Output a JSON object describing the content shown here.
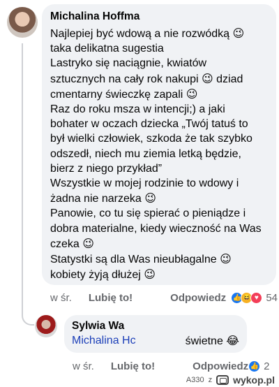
{
  "comment": {
    "author": "Michalina Hoffmann",
    "author_shown": "Michalina Hoffma",
    "lines": [
      {
        "text": "Najlepiej być wdową a nie rozwódką ",
        "emoji": "😉"
      },
      {
        "text": "taka delikatna sugestia",
        "emoji": ""
      },
      {
        "text": "Lastryko się naciągnie, kwiatów",
        "emoji": ""
      },
      {
        "text": "sztucznych na cały rok nakupi ",
        "emoji": "😉",
        "after": " dziad"
      },
      {
        "text": "cmentarny świeczkę zapali ",
        "emoji": "😉"
      },
      {
        "text": "Raz do roku msza w intencji;) a jaki",
        "emoji": ""
      },
      {
        "text": "bohater w oczach dziecka „Twój tatuś to",
        "emoji": ""
      },
      {
        "text": "był wielki człowiek, szkoda że tak szybko",
        "emoji": ""
      },
      {
        "text": "odszedł, niech mu ziemia letką będzie,",
        "emoji": ""
      },
      {
        "text": "bierz z niego przykład”",
        "emoji": ""
      },
      {
        "text": "Wszystkie w mojej rodzinie to wdowy i",
        "emoji": ""
      },
      {
        "text": "żadna nie narzeka ",
        "emoji": "😉"
      },
      {
        "text": "Panowie, co tu się spierać o pieniądze i",
        "emoji": ""
      },
      {
        "text": "dobra materialne, kiedy wieczność na Was",
        "emoji": ""
      },
      {
        "text": "czeka ",
        "emoji": "😉"
      },
      {
        "text": "Statystki są dla Was nieubłagalne ",
        "emoji": "😉"
      },
      {
        "text": "kobiety żyją dłużej ",
        "emoji": "😉"
      }
    ],
    "time": "w śr.",
    "like_label": "Lubię to!",
    "reply_label": "Odpowiedz",
    "reaction_count": "54"
  },
  "reply": {
    "author": "Sylwia Waniewska",
    "author_shown": "Sylwia Wa",
    "mention": "Michalina Hoffmann",
    "mention_shown": "Michalina Hc",
    "text": "świetne ",
    "emoji": "😂",
    "time": "w śr.",
    "like_label": "Lubię to!",
    "reply_label": "Odpowiedz",
    "reaction_count": "2"
  },
  "footer": {
    "tag": "A330",
    "z": "z",
    "brand": "wykop.pl"
  },
  "colors": {
    "bubble": "#f0f2f5",
    "meta": "#65676b",
    "mention": "#1c3fb8",
    "like": "#1877f2",
    "haha": "#f7b125",
    "love": "#f33e58"
  },
  "icons": {
    "like": "thumbs-up-icon",
    "haha": "laughing-face-icon",
    "love": "heart-icon"
  }
}
